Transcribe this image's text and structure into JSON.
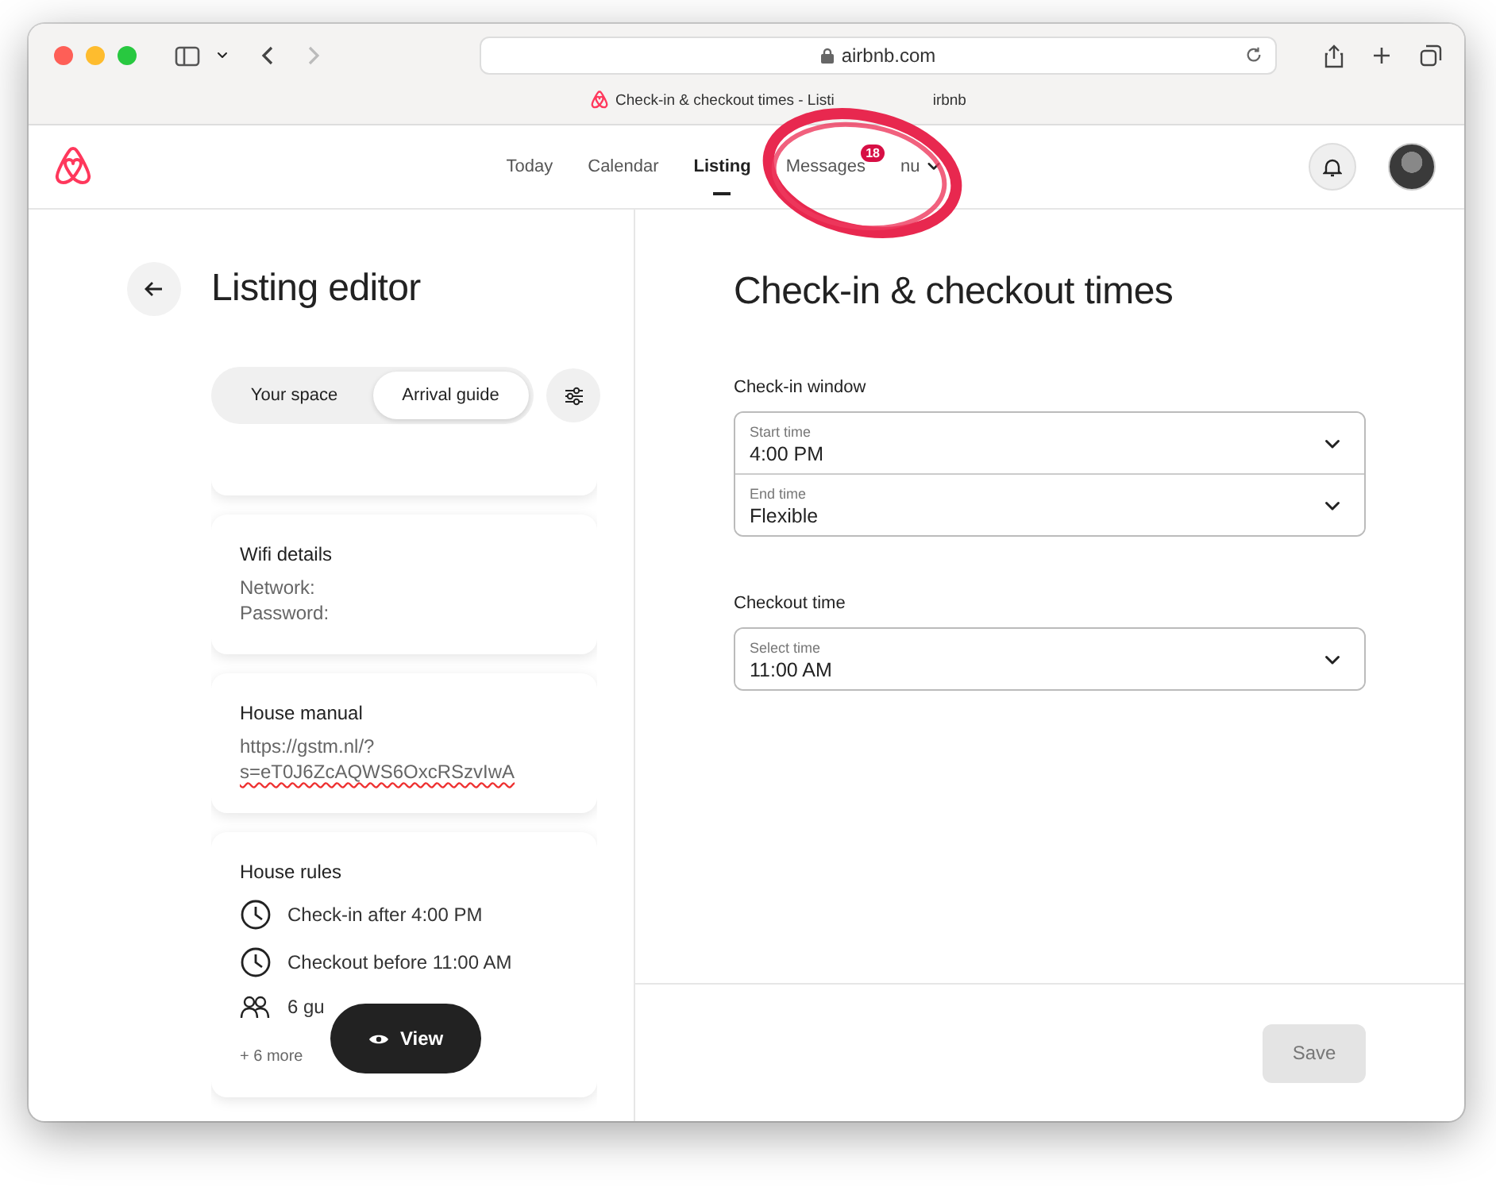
{
  "browser": {
    "address": "airbnb.com",
    "tab_title_parts": [
      "Check-in & checkout times - Listi",
      "irbnb"
    ]
  },
  "nav": {
    "items": [
      {
        "label": "Today",
        "selected": false
      },
      {
        "label": "Calendar",
        "selected": false
      },
      {
        "label": "Listing",
        "selected": true
      },
      {
        "label": "Messages",
        "selected": false,
        "badge": "18"
      },
      {
        "label": "nu",
        "selected": false,
        "dropdown": true
      }
    ]
  },
  "editor": {
    "title": "Listing editor",
    "tabs": [
      {
        "label": "Your space",
        "selected": false
      },
      {
        "label": "Arrival guide",
        "selected": true
      }
    ],
    "cards": [
      {
        "kind": "partial"
      },
      {
        "kind": "text",
        "title": "Wifi details",
        "lines": [
          {
            "text": "Network:",
            "spelling_error": false
          },
          {
            "text": "Password:",
            "spelling_error": false
          }
        ]
      },
      {
        "kind": "text",
        "title": "House manual",
        "lines": [
          {
            "text": "https://gstm.nl/?",
            "spelling_error": false
          },
          {
            "text": "s=eT0J6ZcAQWS6OxcRSzvIwA",
            "spelling_error": true
          }
        ]
      },
      {
        "kind": "rules",
        "title": "House rules",
        "rules": [
          {
            "kind": "clock",
            "text": "Check-in after 4:00 PM"
          },
          {
            "kind": "clock",
            "text": "Checkout before 11:00 AM"
          },
          {
            "kind": "guests",
            "text": "6 gu"
          }
        ],
        "more": "+ 6 more"
      }
    ],
    "view_button": "View"
  },
  "settings": {
    "title": "Check-in & checkout times",
    "sections": [
      {
        "title": "Check-in window",
        "fields": [
          {
            "label": "Start time",
            "value": "4:00 PM"
          },
          {
            "label": "End time",
            "value": "Flexible"
          }
        ]
      },
      {
        "title": "Checkout time",
        "fields": [
          {
            "label": "Select time",
            "value": "11:00 AM"
          }
        ]
      }
    ],
    "save": {
      "label": "Save",
      "disabled": true
    }
  }
}
